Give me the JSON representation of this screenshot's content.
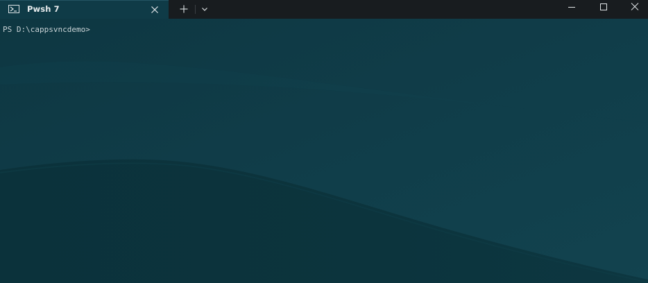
{
  "window": {
    "tab": {
      "title": "Pwsh 7",
      "icon": "powershell-icon",
      "close_icon": "close-icon"
    },
    "new_tab_icon": "plus-icon",
    "dropdown_icon": "chevron-down-icon",
    "controls": {
      "minimize_icon": "minimize-icon",
      "maximize_icon": "maximize-icon",
      "close_icon": "close-icon"
    }
  },
  "terminal": {
    "prompt": "PS D:\\cappsvncdemo>"
  },
  "colors": {
    "titlebar": "#181c1f",
    "tab_active": "#0f3b47",
    "terminal_bg": "#0f3a46",
    "hill": "#0a3038",
    "text": "#c9d3d6"
  }
}
